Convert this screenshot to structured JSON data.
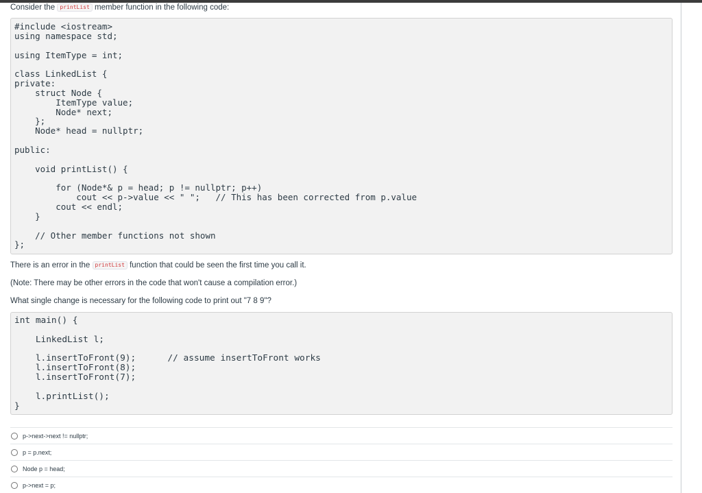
{
  "question": {
    "intro_before": "Consider the",
    "func_name": "printList",
    "intro_after": "member function in the following code:",
    "code1": "#include <iostream>\nusing namespace std;\n\nusing ItemType = int;\n\nclass LinkedList {\nprivate:\n    struct Node {\n        ItemType value;\n        Node* next;\n    };\n    Node* head = nullptr;\n\npublic:\n\n    void printList() {\n\n        for (Node*& p = head; p != nullptr; p++)\n            cout << p->value << \" \";   // This has been corrected from p.value\n        cout << endl;\n    }\n\n    // Other member functions not shown\n};",
    "error_before": "There is an error in the",
    "error_after": "function that could be seen the first time you call it.",
    "note": "(Note: There may be other errors in the code that won't cause a compilation error.)",
    "prompt": "What single change is necessary for the following code to print out \"7 8 9\"?",
    "code2": "int main() {\n\n    LinkedList l;\n\n    l.insertToFront(9);      // assume insertToFront works\n    l.insertToFront(8);\n    l.insertToFront(7);\n\n    l.printList();\n}"
  },
  "answers": [
    {
      "label": "p->next->next != nullptr;"
    },
    {
      "label": "p = p.next;"
    },
    {
      "label": "Node p = head;"
    },
    {
      "label": "p->next = p;"
    }
  ]
}
